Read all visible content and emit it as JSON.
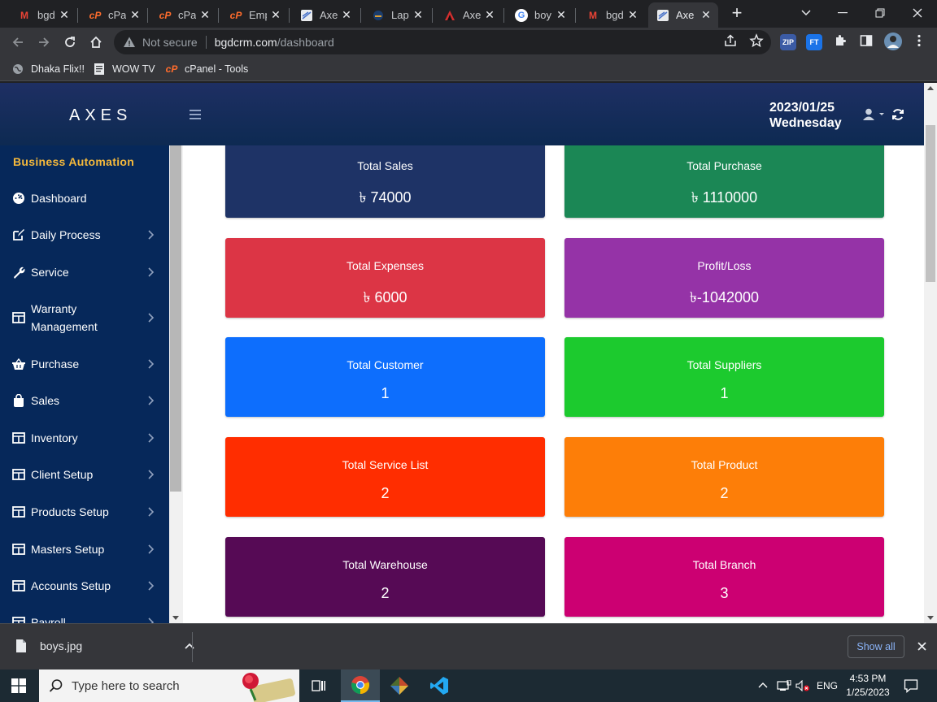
{
  "browser": {
    "tabs": [
      {
        "label": "bgd",
        "icon": "gmail-icon",
        "color": "#ea4335"
      },
      {
        "label": "cPan",
        "icon": "cpanel-icon",
        "color": "#ff6c2c"
      },
      {
        "label": "cPan",
        "icon": "cpanel-icon",
        "color": "#ff6c2c"
      },
      {
        "label": "Emp",
        "icon": "cpanel-icon",
        "color": "#ff6c2c"
      },
      {
        "label": "Axe",
        "icon": "axes-icon",
        "color": "#4a73c9"
      },
      {
        "label": "Lapt",
        "icon": "laptop-icon",
        "color": "#e0a030"
      },
      {
        "label": "Axe",
        "icon": "axes-triangle-icon",
        "color": "#d32f2f"
      },
      {
        "label": "boy",
        "icon": "google-icon",
        "color": "#4285f4"
      },
      {
        "label": "bgd",
        "icon": "gmail-icon",
        "color": "#ea4335"
      },
      {
        "label": "Axe",
        "icon": "axes-icon",
        "color": "#4a73c9"
      }
    ],
    "address": {
      "security": "Not secure",
      "host": "bgdcrm.com",
      "path": "/dashboard"
    },
    "extensions": [
      "ZIP",
      "FT"
    ],
    "bookmarks": [
      {
        "label": "Dhaka Flix!!",
        "icon": "globe-icon"
      },
      {
        "label": "WOW TV",
        "icon": "page-icon"
      },
      {
        "label": "cPanel - Tools",
        "icon": "cpanel-icon"
      }
    ]
  },
  "app": {
    "brand": "AXES",
    "date": "2023/01/25",
    "weekday": "Wednesday",
    "sidebar": {
      "title": "Business Automation",
      "items": [
        {
          "label": "Dashboard",
          "icon": "dashboard-icon",
          "chevron": false
        },
        {
          "label": "Daily Process",
          "icon": "edit-icon",
          "chevron": true
        },
        {
          "label": "Service",
          "icon": "wrench-icon",
          "chevron": true
        },
        {
          "label": "Warranty",
          "label2": "Management",
          "icon": "table-icon",
          "chevron": true
        },
        {
          "label": "Purchase",
          "icon": "basket-icon",
          "chevron": true
        },
        {
          "label": "Sales",
          "icon": "bag-icon",
          "chevron": true
        },
        {
          "label": "Inventory",
          "icon": "table-icon",
          "chevron": true
        },
        {
          "label": "Client Setup",
          "icon": "table-icon",
          "chevron": true
        },
        {
          "label": "Products Setup",
          "icon": "table-icon",
          "chevron": true
        },
        {
          "label": "Masters Setup",
          "icon": "table-icon",
          "chevron": true
        },
        {
          "label": "Accounts Setup",
          "icon": "table-icon",
          "chevron": true
        },
        {
          "label": "Payroll",
          "icon": "table-icon",
          "chevron": true
        }
      ]
    },
    "cards": [
      {
        "title": "Total Sales",
        "value": "৳ 74000",
        "color": "#1e3366"
      },
      {
        "title": "Total Purchase",
        "value": "৳ 1110000",
        "color": "#1b8755"
      },
      {
        "title": "Total Expenses",
        "value": "৳ 6000",
        "color": "#dc3545"
      },
      {
        "title": "Profit/Loss",
        "value": "৳-1042000",
        "color": "#9533a7"
      },
      {
        "title": "Total Customer",
        "value": "1",
        "color": "#0d6efd"
      },
      {
        "title": "Total Suppliers",
        "value": "1",
        "color": "#1cca2e"
      },
      {
        "title": "Total Service List",
        "value": "2",
        "color": "#ff2d00"
      },
      {
        "title": "Total Product",
        "value": "2",
        "color": "#fd7e08"
      },
      {
        "title": "Total Warehouse",
        "value": "2",
        "color": "#560a55"
      },
      {
        "title": "Total Branch",
        "value": "3",
        "color": "#cc0072"
      }
    ]
  },
  "downloads": {
    "file": "boys.jpg",
    "show_all": "Show all"
  },
  "taskbar": {
    "search_placeholder": "Type here to search",
    "language": "ENG",
    "time": "4:53 PM",
    "date": "1/25/2023"
  }
}
